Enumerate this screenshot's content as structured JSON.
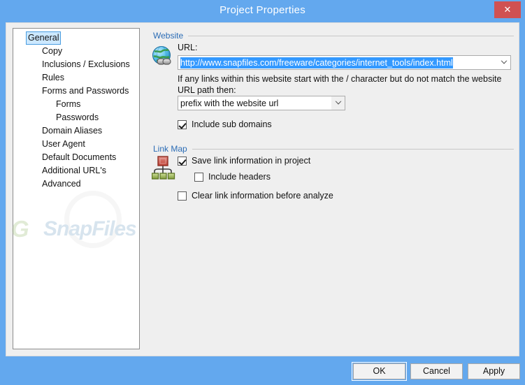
{
  "window": {
    "title": "Project Properties",
    "close_label": "✕"
  },
  "sidebar": {
    "items": [
      {
        "label": "General",
        "indent": 0,
        "expander": "open",
        "selected": true
      },
      {
        "label": "Copy",
        "indent": 1,
        "expander": "none",
        "selected": false
      },
      {
        "label": "Inclusions / Exclusions",
        "indent": 1,
        "expander": "none",
        "selected": false
      },
      {
        "label": "Rules",
        "indent": 1,
        "expander": "none",
        "selected": false
      },
      {
        "label": "Forms and Passwords",
        "indent": 1,
        "expander": "open",
        "selected": false
      },
      {
        "label": "Forms",
        "indent": 2,
        "expander": "none",
        "selected": false
      },
      {
        "label": "Passwords",
        "indent": 2,
        "expander": "none",
        "selected": false
      },
      {
        "label": "Domain Aliases",
        "indent": 1,
        "expander": "none",
        "selected": false
      },
      {
        "label": "User Agent",
        "indent": 1,
        "expander": "none",
        "selected": false
      },
      {
        "label": "Default Documents",
        "indent": 1,
        "expander": "none",
        "selected": false
      },
      {
        "label": "Additional URL's",
        "indent": 1,
        "expander": "none",
        "selected": false
      },
      {
        "label": "Advanced",
        "indent": 1,
        "expander": "none",
        "selected": false
      }
    ]
  },
  "website_group": {
    "title": "Website",
    "url_label": "URL:",
    "url_value": "http://www.snapfiles.com/freeware/categories/internet_tools/index.html",
    "hint_text": "If any links within this website start with the / character but do not match the website URL path then:",
    "prefix_option": "prefix with the website url",
    "include_sub_domains": "Include sub domains",
    "include_sub_domains_checked": true
  },
  "linkmap_group": {
    "title": "Link Map",
    "save_link_info": "Save link information in project",
    "save_link_info_checked": true,
    "include_headers": "Include headers",
    "include_headers_checked": false,
    "clear_link_info": "Clear link information before analyze",
    "clear_link_info_checked": false
  },
  "watermark": {
    "prefix": "G",
    "text": "SnapFiles"
  },
  "footer": {
    "ok": "OK",
    "cancel": "Cancel",
    "apply": "Apply"
  },
  "colors": {
    "titlebar": "#63a8ee",
    "close": "#d05152",
    "group_title": "#2b6cb5",
    "selection": "#3399ff",
    "content_bg": "#efefef"
  }
}
